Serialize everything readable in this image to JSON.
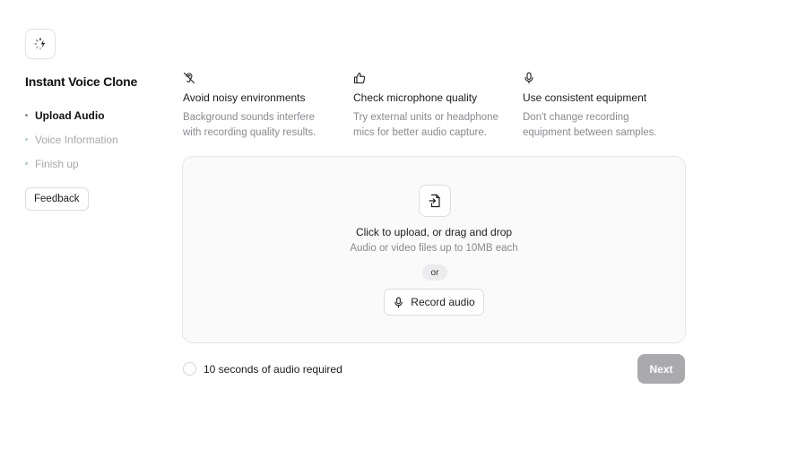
{
  "sidebar": {
    "title": "Instant Voice Clone",
    "steps": [
      {
        "label": "Upload Audio",
        "state": "active"
      },
      {
        "label": "Voice Information",
        "state": "inactive"
      },
      {
        "label": "Finish up",
        "state": "inactive"
      }
    ],
    "feedback_label": "Feedback"
  },
  "tips": [
    {
      "icon": "ear-off-icon",
      "title": "Avoid noisy environments",
      "desc_line1": "Background sounds interfere",
      "desc_line2": "with recording quality results."
    },
    {
      "icon": "thumbs-up-icon",
      "title": "Check microphone quality",
      "desc_line1": "Try external units or headphone",
      "desc_line2": "mics for better audio capture."
    },
    {
      "icon": "microphone-icon",
      "title": "Use consistent equipment",
      "desc_line1": "Don't change recording",
      "desc_line2": "equipment between samples."
    }
  ],
  "upload": {
    "title": "Click to upload, or drag and drop",
    "subtitle": "Audio or video files up to 10MB each",
    "or_label": "or",
    "record_label": "Record audio"
  },
  "footer": {
    "requirement": "10 seconds of audio required",
    "next_label": "Next"
  },
  "colors": {
    "next_disabled_bg": "#a9a9ae",
    "inactive_step_dot": "#9fd7b4",
    "dropzone_bg": "#fafafa"
  }
}
